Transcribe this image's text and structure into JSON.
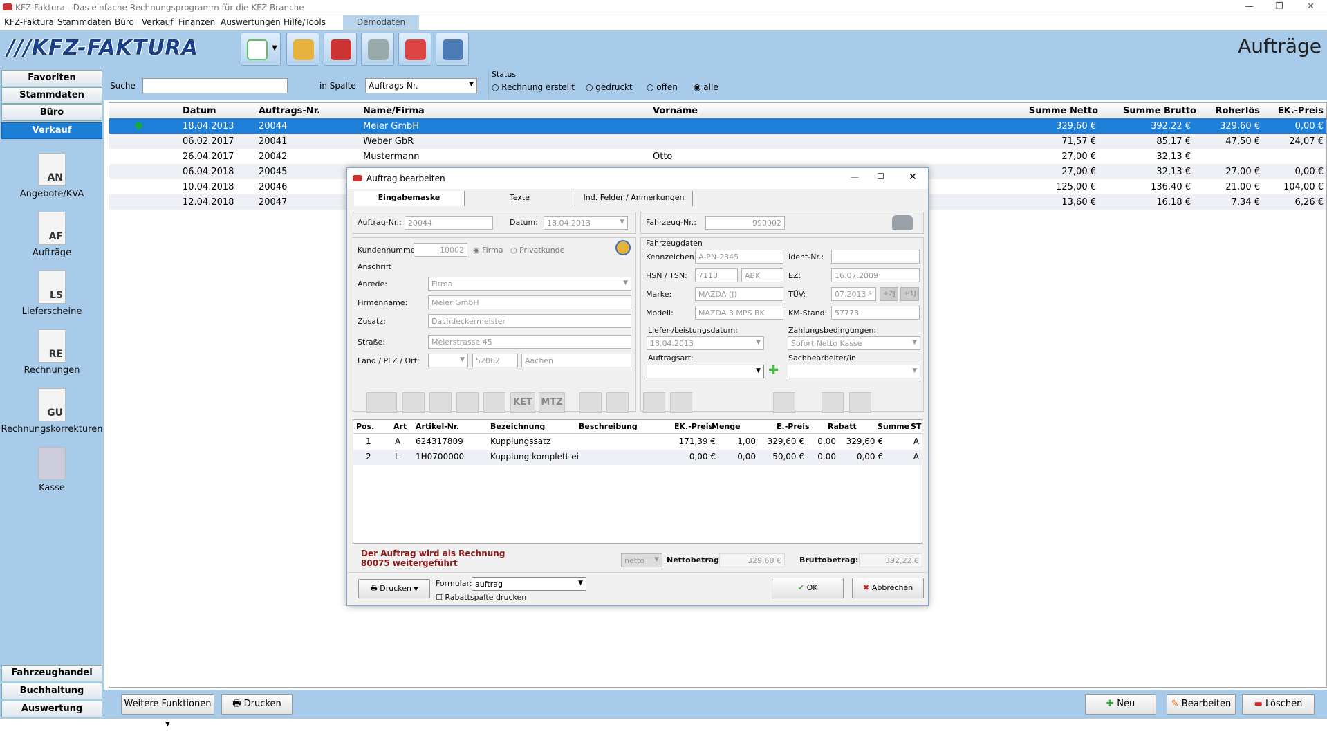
{
  "window": {
    "title": "KFZ-Faktura - Das einfache Rechnungsprogramm für die KFZ-Branche"
  },
  "menu": [
    "KFZ-Faktura",
    "Stammdaten",
    "Büro",
    "Verkauf",
    "Finanzen",
    "Auswertungen",
    "Hilfe/Tools"
  ],
  "demo_tab": "Demodaten",
  "logo": "///KFZ-FAKTURA",
  "page_title": "Aufträge",
  "sidebar": {
    "top": [
      "Favoriten",
      "Stammdaten",
      "Büro",
      "Verkauf"
    ],
    "modules": [
      {
        "code": "AN",
        "label": "Angebote/KVA"
      },
      {
        "code": "AF",
        "label": "Aufträge"
      },
      {
        "code": "LS",
        "label": "Lieferscheine"
      },
      {
        "code": "RE",
        "label": "Rechnungen"
      },
      {
        "code": "GU",
        "label": "Rechnungskorrekturen"
      },
      {
        "code": "",
        "label": "Kasse"
      }
    ],
    "bottom": [
      "Fahrzeughandel",
      "Buchhaltung",
      "Auswertung"
    ]
  },
  "filter": {
    "search_label": "Suche",
    "search_value": "",
    "column_label": "in Spalte",
    "column_value": "Auftrags-Nr.",
    "status_label": "Status",
    "status_options": [
      "Rechnung erstellt",
      "gedruckt",
      "offen",
      "alle"
    ],
    "status_selected": "alle"
  },
  "grid": {
    "headers": [
      "Datum",
      "Auftrags-Nr.",
      "Name/Firma",
      "Vorname",
      "Summe Netto",
      "Summe Brutto",
      "Roherlös",
      "EK.-Preis"
    ],
    "rows": [
      [
        "18.04.2013",
        "20044",
        "Meier GmbH",
        "",
        "329,60 €",
        "392,22 €",
        "329,60 €",
        "0,00 €"
      ],
      [
        "06.02.2017",
        "20041",
        "Weber GbR",
        "",
        "71,57 €",
        "85,17 €",
        "47,50 €",
        "24,07 €"
      ],
      [
        "26.04.2017",
        "20042",
        "Mustermann",
        "Otto",
        "27,00 €",
        "32,13 €",
        "",
        ""
      ],
      [
        "06.04.2018",
        "20045",
        "",
        "",
        "27,00 €",
        "32,13 €",
        "27,00 €",
        "0,00 €"
      ],
      [
        "10.04.2018",
        "20046",
        "",
        "",
        "125,00 €",
        "136,40 €",
        "21,00 €",
        "104,00 €"
      ],
      [
        "12.04.2018",
        "20047",
        "",
        "",
        "13,60 €",
        "16,18 €",
        "7,34 €",
        "6,26 €"
      ]
    ]
  },
  "bottom": {
    "weitere": "Weitere Funktionen",
    "drucken": "Drucken",
    "neu": "Neu",
    "bearbeiten": "Bearbeiten",
    "loeschen": "Löschen"
  },
  "dialog": {
    "title": "Auftrag bearbeiten",
    "tabs": [
      "Eingabemaske",
      "Texte",
      "Ind. Felder / Anmerkungen"
    ],
    "auftrag_nr_label": "Auftrag-Nr.:",
    "auftrag_nr": "20044",
    "datum_label": "Datum:",
    "datum": "18.04.2013",
    "kundennr_label": "Kundennummer:",
    "kundennr": "10002",
    "firma": "Firma",
    "privatkunde": "Privatkunde",
    "anschrift": "Anschrift",
    "anrede_label": "Anrede:",
    "anrede": "Firma",
    "firmenname_label": "Firmenname:",
    "firmenname": "Meier GmbH",
    "zusatz_label": "Zusatz:",
    "zusatz": "Dachdeckermeister",
    "strasse_label": "Straße:",
    "strasse": "Meierstrasse 45",
    "land_label": "Land / PLZ / Ort:",
    "land": "",
    "plz": "52062",
    "ort": "Aachen",
    "fahrzeug_nr_label": "Fahrzeug-Nr.:",
    "fahrzeug_nr": "990002",
    "fahrzeugdaten": "Fahrzeugdaten",
    "kennzeichen_label": "Kennzeichen:",
    "kennzeichen": "A-PN-2345",
    "ident_label": "Ident-Nr.:",
    "ident": "",
    "hsn_label": "HSN / TSN:",
    "hsn": "7118",
    "tsn": "ABK",
    "ez_label": "EZ:",
    "ez": "16.07.2009",
    "marke_label": "Marke:",
    "marke": "MAZDA (J)",
    "tuev_label": "TÜV:",
    "tuev": "07.2013",
    "tuev_p2": "+2J",
    "tuev_p1": "+1J",
    "modell_label": "Modell:",
    "modell": "MAZDA 3 MPS BK",
    "km_label": "KM-Stand:",
    "km": "57778",
    "liefer_label": "Liefer-/Leistungsdatum:",
    "liefer": "18.04.2013",
    "zahlung_label": "Zahlungsbedingungen:",
    "zahlung": "Sofort Netto Kasse",
    "auftragsart_label": "Auftragsart:",
    "auftragsart": "",
    "sach_label": "Sachbearbeiter/in",
    "sach": "",
    "icon_btn_ket": "KET",
    "icon_btn_mtz": "MTZ",
    "pos_headers": [
      "Pos.",
      "Art",
      "Artikel-Nr.",
      "Bezeichnung",
      "Beschreibung",
      "EK.-Preis",
      "Menge",
      "E.-Preis",
      "Rabatt",
      "Summe",
      "ST"
    ],
    "pos_rows": [
      [
        "1",
        "A",
        "624317809",
        "Kupplungssatz",
        "",
        "171,39 €",
        "1,00",
        "329,60 €",
        "0,00",
        "329,60 €",
        "A"
      ],
      [
        "2",
        "L",
        "1H0700000",
        "Kupplung komplett ei",
        "",
        "0,00 €",
        "0,00",
        "50,00 €",
        "0,00",
        "0,00 €",
        "A"
      ]
    ],
    "notice": "Der Auftrag wird als Rechnung 80075 weitergeführt",
    "mode": "netto",
    "netto_label": "Nettobetrag:",
    "netto": "329,60 €",
    "brutto_label": "Bruttobetrag:",
    "brutto": "392,22 €",
    "drucken": "Drucken",
    "formular_label": "Formular:",
    "formular": "auftrag",
    "rabatt_check": "Rabattspalte drucken",
    "ok": "OK",
    "abbrechen": "Abbrechen"
  },
  "colors": {
    "accent": "#1e7fd8",
    "panel": "#a9cbea",
    "notice": "#8b1a1a"
  }
}
